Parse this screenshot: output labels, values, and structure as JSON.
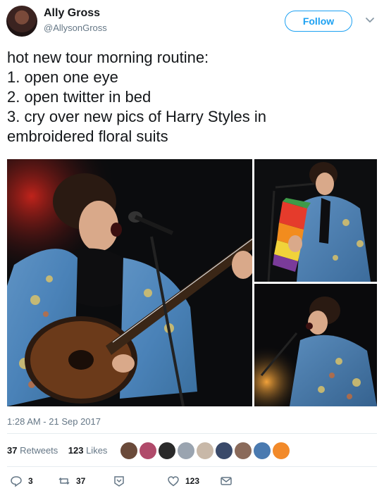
{
  "author": {
    "name": "Ally Gross",
    "handle": "@AllysonGross"
  },
  "follow_label": "Follow",
  "tweet_lines": [
    "hot new tour morning routine:",
    "1. open one eye",
    "2. open twitter in bed",
    "3. cry over new pics of Harry Styles in",
    "embroidered floral suits"
  ],
  "timestamp": "1:28 AM - 21 Sep 2017",
  "stats": {
    "retweets_count": "37",
    "retweets_label": "Retweets",
    "likes_count": "123",
    "likes_label": "Likes"
  },
  "actions": {
    "reply_count": "3",
    "retweet_count": "37",
    "like_count": "123"
  },
  "colors": {
    "accent": "#1da1f2",
    "secondary_text": "#657786"
  },
  "icons": [
    "chevron-down-icon",
    "reply-icon",
    "retweet-icon",
    "heart-icon",
    "direct-message-icon",
    "caret-down-icon"
  ]
}
